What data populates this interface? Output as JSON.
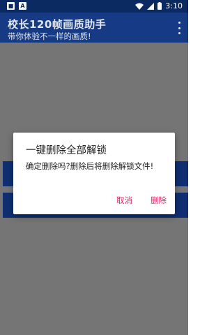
{
  "status_bar": {
    "time": "3:10",
    "left_icons": [
      "notification-icon-1",
      "notification-icon-2"
    ],
    "right_icons": [
      "wifi-icon",
      "signal-icon",
      "battery-icon"
    ]
  },
  "app_bar": {
    "title": "校长120帧画质助手",
    "subtitle": "带你体验不一样的画质!"
  },
  "dialog": {
    "title": "一键删除全部解锁",
    "message": "确定删除吗?删除后将删除解锁文件!",
    "cancel_label": "取消",
    "confirm_label": "删除"
  },
  "colors": {
    "status_bar": "#0c2a62",
    "app_bar": "#173a84",
    "accent": "#e91e63",
    "scrim": "#757575"
  }
}
